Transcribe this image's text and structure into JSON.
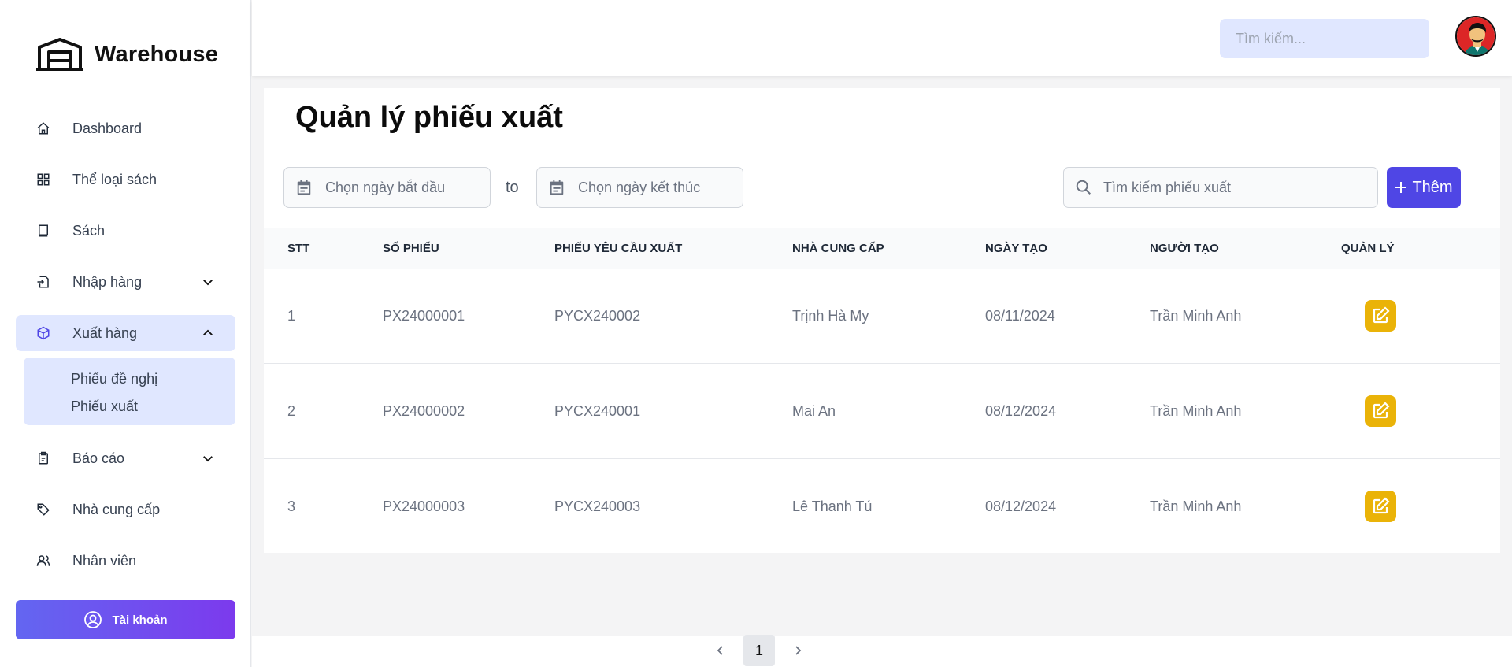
{
  "brand": {
    "name": "Warehouse"
  },
  "sidebar": {
    "items": [
      {
        "label": "Dashboard",
        "icon": "home-icon"
      },
      {
        "label": "Thể loại sách",
        "icon": "grid-icon"
      },
      {
        "label": "Sách",
        "icon": "book-icon"
      },
      {
        "label": "Nhập hàng",
        "icon": "import-icon",
        "chevron": "chevron-down-icon"
      },
      {
        "label": "Xuất hàng",
        "icon": "box-icon",
        "chevron": "chevron-up-icon",
        "active": true
      },
      {
        "label": "Báo cáo",
        "icon": "report-icon",
        "chevron": "chevron-down-icon"
      },
      {
        "label": "Nhà cung cấp",
        "icon": "tag-icon"
      },
      {
        "label": "Nhân viên",
        "icon": "users-icon"
      }
    ],
    "submenu": [
      "Phiếu đề nghị",
      "Phiếu xuất"
    ],
    "account_label": "Tài khoản"
  },
  "topbar": {
    "search_placeholder": "Tìm kiếm..."
  },
  "main": {
    "title": "Quản lý phiếu xuất",
    "start_date_placeholder": "Chọn ngày bắt đầu",
    "to_label": "to",
    "end_date_placeholder": "Chọn ngày kết thúc",
    "search_placeholder": "Tìm kiếm phiếu xuất",
    "add_label": "Thêm",
    "table": {
      "headers": [
        "STT",
        "Số phiếu",
        "Phiếu yêu cầu xuất",
        "Nhà cung cấp",
        "Ngày tạo",
        "Người tạo",
        "Quản lý"
      ],
      "rows": [
        [
          "1",
          "PX24000001",
          "PYCX240002",
          "Trịnh Hà My",
          "08/11/2024",
          "Trần Minh Anh"
        ],
        [
          "2",
          "PX24000002",
          "PYCX240001",
          "Mai An",
          "08/12/2024",
          "Trần Minh Anh"
        ],
        [
          "3",
          "PX24000003",
          "PYCX240003",
          "Lê Thanh Tú",
          "08/12/2024",
          "Trần Minh Anh"
        ]
      ]
    }
  },
  "pagination": {
    "current_page": "1"
  },
  "colors": {
    "accent": "#4f46e5",
    "active_bg": "#e0e7ff",
    "edit": "#eab308"
  }
}
